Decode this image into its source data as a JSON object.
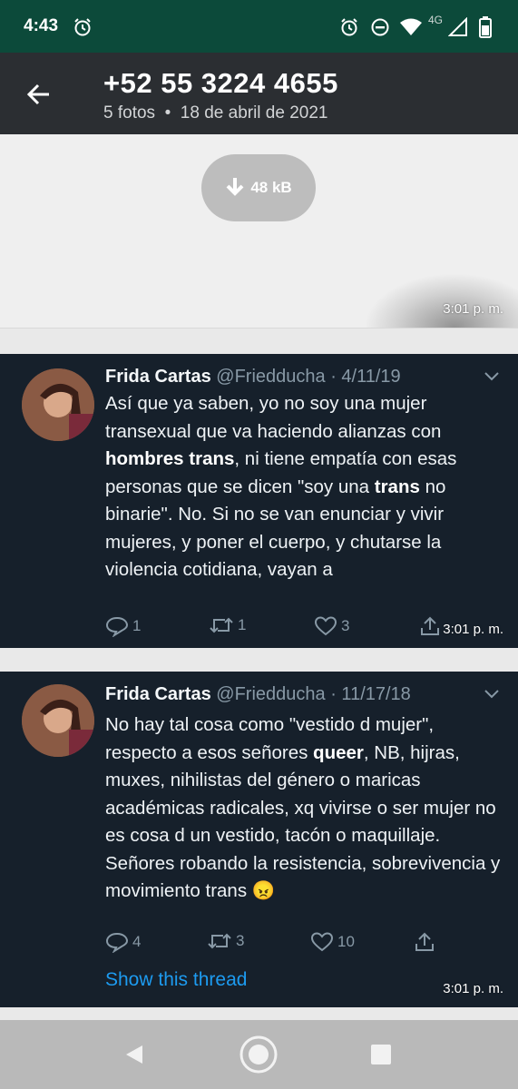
{
  "status_bar": {
    "time": "4:43",
    "network_label": "4G",
    "icons": [
      "alarm-icon",
      "alarm-icon",
      "do-not-disturb-icon",
      "wifi-icon",
      "signal-icon",
      "battery-icon"
    ]
  },
  "app_bar": {
    "title": "+52 55 3224 4655",
    "subtitle": "5 fotos  •  18 de abril de 2021"
  },
  "photo_1": {
    "download_size": "48 kB",
    "timestamp": "3:01 p. m."
  },
  "tweets": [
    {
      "name": "Frida Cartas",
      "handle": "@Friedducha",
      "date": "· 4/11/19",
      "body": [
        {
          "t": "Así que ya saben, yo no soy una mujer transexual que va haciendo alianzas con "
        },
        {
          "t": "hombres trans",
          "b": true
        },
        {
          "t": ", ni tiene empatía con esas personas que se dicen \"soy una "
        },
        {
          "t": "trans",
          "b": true
        },
        {
          "t": " no binarie\". No. Si no se van enunciar y vivir mujeres, y poner el cuerpo, y chutarse la violencia cotidiana, vayan a"
        }
      ],
      "replies": "1",
      "retweets": "1",
      "likes": "3",
      "timestamp": "3:01 p. m."
    },
    {
      "name": "Frida Cartas",
      "handle": "@Friedducha",
      "date": "· 11/17/18",
      "body": [
        {
          "t": "No hay tal cosa como \"vestido d mujer\", respecto a esos señores "
        },
        {
          "t": "queer",
          "b": true
        },
        {
          "t": ", NB, hijras, muxes, nihilistas del género o maricas académicas radicales, xq vivirse o ser mujer no es cosa d un vestido, tacón o maquillaje. Señores robando la resistencia, sobrevivencia y movimiento trans 😠"
        }
      ],
      "replies": "4",
      "retweets": "3",
      "likes": "10",
      "thread_link": "Show this thread",
      "timestamp": "3:01 p. m."
    }
  ],
  "colors": {
    "status_bar": "#0c4a3a",
    "app_bar": "#2b2e32",
    "tweet_bg": "#16202b",
    "link_blue": "#1d9bf0",
    "muted": "#8899a6"
  }
}
